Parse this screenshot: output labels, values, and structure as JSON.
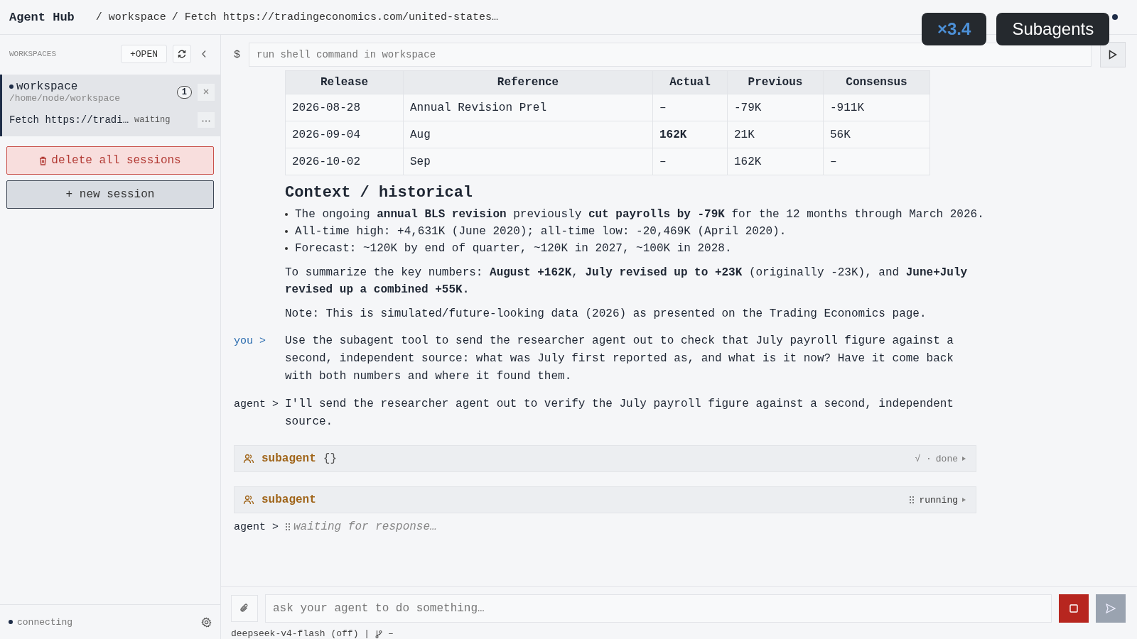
{
  "header": {
    "title": "Agent Hub",
    "breadcrumb": [
      "/ workspace",
      "/ Fetch https://tradingeconomics.com/united-states…"
    ]
  },
  "overlay": {
    "speed": "×3.4",
    "label": "Subagents"
  },
  "sidebar": {
    "heading": "WORKSPACES",
    "open_button": "+OPEN",
    "workspaces": [
      {
        "name": "workspace",
        "path": "/home/node/workspace",
        "count": "1",
        "selected": true,
        "sessions": [
          {
            "title": "Fetch https://tradi…",
            "status": "waiting"
          }
        ]
      }
    ],
    "delete_button": "delete all sessions",
    "new_button": "+ new session",
    "status": "connecting"
  },
  "shell": {
    "prompt": "$",
    "placeholder": "run shell command in workspace"
  },
  "table": {
    "columns": [
      "Release",
      "Reference",
      "Actual",
      "Previous",
      "Consensus"
    ],
    "rows": [
      {
        "cells": [
          {
            "text": "2026-08-28",
            "bold": false
          },
          {
            "text": "Annual Revision Prel",
            "bold": false
          },
          {
            "text": "–",
            "bold": false
          },
          {
            "text": "-79K",
            "bold": false
          },
          {
            "text": "-911K",
            "bold": false
          }
        ]
      },
      {
        "cells": [
          {
            "text": "2026-09-04",
            "bold": false
          },
          {
            "text": "Aug",
            "bold": false
          },
          {
            "text": "162K",
            "bold": true
          },
          {
            "text": "21K",
            "bold": false
          },
          {
            "text": "56K",
            "bold": false
          }
        ]
      },
      {
        "cells": [
          {
            "text": "2026-10-02",
            "bold": false
          },
          {
            "text": "Sep",
            "bold": false
          },
          {
            "text": "–",
            "bold": false
          },
          {
            "text": "162K",
            "bold": false
          },
          {
            "text": "–",
            "bold": false
          }
        ]
      }
    ]
  },
  "heading": "Context / historical",
  "bullets": [
    "The ongoing **annual BLS revision** previously **cut payrolls by -79K** for the 12 months through March 2026.",
    "All-time high: +4,631K (June 2020); all-time low: -20,469K (April 2020).",
    "Forecast: ~120K by end of quarter, ~120K in 2027, ~100K in 2028."
  ],
  "paragraphs": [
    "To summarize the key numbers: **August +162K**, **July revised up to +23K** (originally -23K), and **June+July revised up a combined +55K.**",
    "Note: This is simulated/future-looking data (2026) as presented on the Trading Economics page."
  ],
  "transcript": [
    {
      "kind": "message",
      "role": "you >",
      "text": "Use the subagent tool to send the researcher agent out to check that July payroll figure against a second, independent source: what was July first reported as, and what is it now? Have it come back with both numbers and where it found them."
    },
    {
      "kind": "message",
      "role": "agent >",
      "text": "I'll send the researcher agent out to verify the July payroll figure against a second, independent source."
    },
    {
      "kind": "tool",
      "name": "subagent",
      "args": "{}",
      "mark": "√ ·",
      "status": "done"
    },
    {
      "kind": "tool",
      "name": "subagent",
      "status": "running"
    },
    {
      "kind": "waiting",
      "role": "agent >",
      "text": "waiting for response…"
    }
  ],
  "composer": {
    "placeholder": "ask your agent to do something…",
    "model": "deepseek-v4-flash (off) |",
    "branch": "–"
  }
}
